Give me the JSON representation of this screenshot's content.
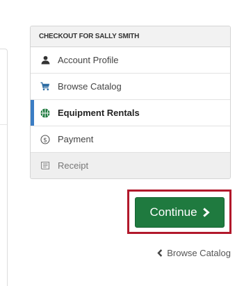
{
  "checkout": {
    "header": "CHECKOUT FOR SALLY SMITH",
    "steps": [
      {
        "label": "Account Profile",
        "icon": "user-icon",
        "state": "done"
      },
      {
        "label": "Browse Catalog",
        "icon": "cart-icon",
        "state": "done"
      },
      {
        "label": "Equipment Rentals",
        "icon": "basketball-icon",
        "state": "active"
      },
      {
        "label": "Payment",
        "icon": "dollar-circle-icon",
        "state": "todo"
      },
      {
        "label": "Receipt",
        "icon": "receipt-icon",
        "state": "disabled"
      }
    ]
  },
  "actions": {
    "continue_label": "Continue",
    "back_label": "Browse Catalog"
  },
  "colors": {
    "primary_green": "#1f7a3f",
    "active_marker": "#3b7dc4",
    "highlight_frame": "#b2182b"
  }
}
